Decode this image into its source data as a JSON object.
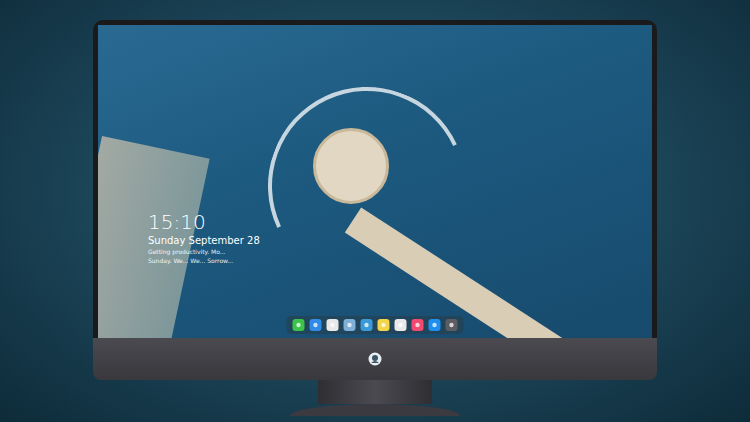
{
  "lock_screen": {
    "time": "15:10",
    "date": "Sunday September 28",
    "notification_lines": [
      "Getting productivity. Mo...",
      "Sunday. We... We... Sorrow..."
    ]
  },
  "dock": {
    "items": [
      {
        "color": "#3cc34a"
      },
      {
        "color": "#2f8ae8"
      },
      {
        "color": "#e8e8e8"
      },
      {
        "color": "#7fb0d8"
      },
      {
        "color": "#3a9ad9"
      },
      {
        "color": "#f3d54a"
      },
      {
        "color": "#e9e9e9"
      },
      {
        "color": "#f14a70"
      },
      {
        "color": "#1e8ef0"
      },
      {
        "color": "#5c5c62"
      }
    ]
  }
}
